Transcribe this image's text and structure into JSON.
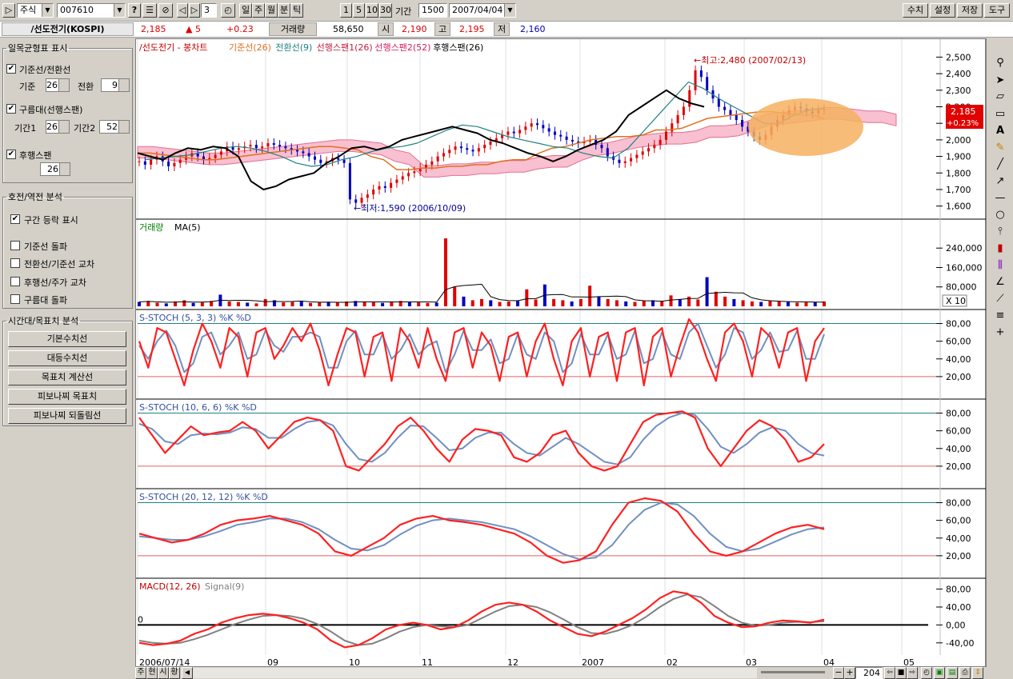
{
  "toolbar": {
    "market": "주식",
    "code": "007610",
    "count_value": "3",
    "period_buttons": [
      "일",
      "주",
      "월",
      "분",
      "틱"
    ],
    "interval_buttons": [
      "1",
      "5",
      "10",
      "30"
    ],
    "period_label": "기간",
    "period_value": "1500",
    "date_value": "2007/04/04",
    "right_buttons": [
      "수치",
      "설정",
      "저장",
      "도구"
    ]
  },
  "info": {
    "name": "/선도전기(KOSPI)",
    "price": "2,185",
    "change": "▲ 5",
    "change_pct": "+0.23",
    "volume_label": "거래량",
    "volume": "58,650",
    "open_label": "시",
    "open": "2,190",
    "high_label": "고",
    "high": "2,195",
    "low_label": "저",
    "low": "2,160"
  },
  "left_panel": {
    "ichimoku_title": "일목균형표 표시",
    "base_conv_label": "기준선/전환선",
    "base_label": "기준",
    "base_value": "26",
    "conv_label": "전환",
    "conv_value": "9",
    "cloud_label": "구름대(선행스팬)",
    "period1_label": "기간1",
    "period1_value": "26",
    "period2_label": "기간2",
    "period2_value": "52",
    "lagging_label": "후행스팬",
    "lagging_value": "26",
    "reversal_title": "호전/역전 분석",
    "range_label": "구간 등락 표시",
    "opt1": "기준선 돌파",
    "opt2": "전환선/기준선 교차",
    "opt3": "후행선/주가 교차",
    "opt4": "구름대 돌파",
    "time_title": "시간대/목표치 분석",
    "buttons": [
      "기본수치선",
      "대등수치선",
      "목표치 계산선",
      "피보나찌 목표치",
      "피보나찌 되돌림선"
    ]
  },
  "chart_data": [
    {
      "type": "line",
      "title": "/선도전기 - 봉차트",
      "legend": [
        "기준선(26)",
        "전환선(9)",
        "선행스팬1(26)",
        "선행스팬2(52)",
        "후행스팬(26)"
      ],
      "legend_colors": [
        "#e07020",
        "#208080",
        "#c02040",
        "#d02060",
        "#000000"
      ],
      "y_ticks": [
        "2,500",
        "2,400",
        "2,300",
        "2,200",
        "2,100",
        "2,000",
        "1,900",
        "1,800",
        "1,700",
        "1,600"
      ],
      "ylim": [
        1550,
        2560
      ],
      "price_tag": "2,185",
      "price_tag_pct": "+0.23%",
      "high_annotation": "←최고:2,480 (2007/02/13)",
      "low_annotation": "←최저:1,590 (2006/10/09)",
      "close": [
        1870,
        1850,
        1880,
        1900,
        1870,
        1840,
        1860,
        1880,
        1900,
        1920,
        1900,
        1880,
        1890,
        1910,
        1930,
        1960,
        1940,
        1950,
        1960,
        1970,
        1950,
        1960,
        1980,
        1970,
        1960,
        1950,
        1940,
        1930,
        1920,
        1900,
        1880,
        1860,
        1870,
        1890,
        1880,
        1860,
        1640,
        1620,
        1650,
        1670,
        1700,
        1720,
        1710,
        1740,
        1760,
        1780,
        1800,
        1810,
        1830,
        1850,
        1870,
        1900,
        1920,
        1940,
        1960,
        1950,
        1940,
        1930,
        1950,
        1970,
        1990,
        2010,
        2030,
        2050,
        2040,
        2060,
        2080,
        2100,
        2090,
        2070,
        2050,
        2030,
        2020,
        2000,
        1990,
        1980,
        1990,
        2000,
        1970,
        1950,
        1900,
        1880,
        1860,
        1870,
        1890,
        1910,
        1930,
        1950,
        1970,
        2000,
        2050,
        2100,
        2150,
        2200,
        2300,
        2420,
        2380,
        2300,
        2250,
        2200,
        2180,
        2150,
        2120,
        2080,
        2050,
        2020,
        2000,
        2030,
        2080,
        2120,
        2150,
        2180,
        2200,
        2190,
        2170,
        2160,
        2180,
        2185
      ],
      "kijun": [
        1920,
        1920,
        1910,
        1900,
        1890,
        1880,
        1880,
        1890,
        1900,
        1910,
        1920,
        1930,
        1940,
        1950,
        1960,
        1960,
        1950,
        1940,
        1900,
        1880,
        1820,
        1820,
        1830,
        1830,
        1840,
        1840,
        1850,
        1850,
        1870,
        1880,
        1880,
        1920,
        1950,
        1960,
        1980,
        2000,
        2010,
        2020,
        2020,
        2030,
        2060,
        2060,
        2070,
        2100,
        2130,
        2140,
        2150,
        2160,
        2170,
        2170,
        2160,
        2150,
        2150,
        2130
      ],
      "tenkan": [
        1880,
        1890,
        1900,
        1910,
        1930,
        1950,
        1960,
        1950,
        1930,
        1900,
        1860,
        1840,
        1850,
        1880,
        1900,
        1930,
        1950,
        1960,
        1980,
        2020,
        2060,
        2090,
        2080,
        2050,
        2020,
        2000,
        1980,
        1960,
        1950,
        1920,
        1900,
        1890,
        1950,
        2050,
        2150,
        2250,
        2350,
        2310,
        2250,
        2200,
        2150,
        2100,
        2100,
        2150,
        2180,
        2190
      ],
      "lagging": [
        1920,
        1900,
        1880,
        1920,
        1950,
        1940,
        1960,
        1950,
        1900,
        1750,
        1700,
        1720,
        1760,
        1780,
        1800,
        1860,
        1900,
        1950,
        1960,
        1940,
        1960,
        2000,
        2020,
        2040,
        2060,
        2080,
        2060,
        2040,
        2000,
        1980,
        1950,
        1920,
        1900,
        1870,
        1900,
        1940,
        1970,
        2000,
        2050,
        2150,
        2200,
        2250,
        2300,
        2250,
        2220,
        2200
      ]
    },
    {
      "type": "bar",
      "title": "거래량",
      "ma_label": "MA(5)",
      "y_ticks": [
        "240,000",
        "160,000",
        "80,000"
      ],
      "ylim": [
        0,
        300000
      ],
      "multiplier_label": "X 10",
      "values": [
        18000,
        22000,
        15000,
        12000,
        20000,
        25000,
        14000,
        16000,
        22000,
        48000,
        20000,
        18000,
        15000,
        12000,
        30000,
        25000,
        16000,
        18000,
        20000,
        14000,
        16000,
        18000,
        15000,
        20000,
        22000,
        18000,
        16000,
        14000,
        20000,
        22000,
        18000,
        16000,
        14000,
        15000,
        280000,
        80000,
        40000,
        25000,
        30000,
        25000,
        18000,
        20000,
        22000,
        70000,
        28000,
        90000,
        30000,
        25000,
        20000,
        30000,
        85000,
        40000,
        30000,
        25000,
        20000,
        18000,
        22000,
        25000,
        20000,
        45000,
        30000,
        40000,
        28000,
        120000,
        60000,
        40000,
        30000,
        25000,
        20000,
        18000,
        22000,
        20000,
        18000,
        15000,
        16000,
        18000,
        20000
      ]
    },
    {
      "type": "line",
      "title": "S-STOCH (5, 3, 3) %K %D",
      "y_ticks": [
        "80,00",
        "60,00",
        "40,00",
        "20,00"
      ],
      "ylim": [
        0,
        85
      ],
      "levels": [
        80,
        20
      ],
      "k": [
        60,
        30,
        75,
        70,
        40,
        10,
        50,
        80,
        60,
        30,
        75,
        65,
        20,
        70,
        75,
        40,
        55,
        75,
        60,
        80,
        50,
        10,
        45,
        75,
        70,
        20,
        65,
        70,
        15,
        75,
        60,
        30,
        75,
        40,
        15,
        70,
        75,
        30,
        70,
        55,
        15,
        65,
        70,
        20,
        60,
        80,
        40,
        10,
        60,
        75,
        20,
        65,
        70,
        15,
        70,
        75,
        10,
        65,
        75,
        20,
        55,
        85,
        70,
        40,
        15,
        70,
        80,
        60,
        20,
        75,
        65,
        30,
        70,
        75,
        15,
        60,
        75
      ],
      "d": [
        55,
        40,
        60,
        72,
        55,
        25,
        35,
        65,
        70,
        45,
        55,
        70,
        40,
        45,
        72,
        55,
        48,
        65,
        65,
        70,
        65,
        30,
        30,
        60,
        72,
        45,
        45,
        68,
        40,
        50,
        68,
        45,
        55,
        60,
        25,
        45,
        72,
        50,
        50,
        62,
        35,
        40,
        68,
        45,
        40,
        70,
        60,
        25,
        35,
        68,
        45,
        45,
        68,
        40,
        45,
        72,
        35,
        40,
        70,
        45,
        40,
        70,
        80,
        55,
        30,
        45,
        75,
        70,
        40,
        50,
        70,
        48,
        50,
        72,
        40,
        40,
        68
      ]
    },
    {
      "type": "line",
      "title": "S-STOCH (10, 6, 6) %K %D",
      "y_ticks": [
        "80,00",
        "60,00",
        "40,00",
        "20,00"
      ],
      "ylim": [
        0,
        85
      ],
      "levels": [
        80,
        20
      ],
      "k": [
        75,
        55,
        35,
        50,
        65,
        55,
        58,
        60,
        70,
        60,
        40,
        55,
        70,
        75,
        72,
        60,
        20,
        15,
        30,
        45,
        65,
        75,
        60,
        40,
        25,
        50,
        62,
        60,
        55,
        30,
        25,
        35,
        55,
        60,
        35,
        20,
        15,
        20,
        45,
        70,
        78,
        80,
        82,
        75,
        40,
        20,
        40,
        60,
        72,
        65,
        50,
        25,
        30,
        45
      ],
      "d": [
        68,
        62,
        48,
        45,
        55,
        57,
        56,
        58,
        64,
        62,
        52,
        52,
        62,
        70,
        72,
        66,
        45,
        28,
        25,
        35,
        52,
        66,
        65,
        52,
        38,
        40,
        52,
        58,
        58,
        45,
        35,
        32,
        42,
        52,
        45,
        35,
        25,
        22,
        30,
        50,
        65,
        75,
        80,
        78,
        62,
        42,
        35,
        45,
        58,
        64,
        60,
        45,
        35,
        32
      ]
    },
    {
      "type": "line",
      "title": "S-STOCH (20, 12, 12) %K %D",
      "y_ticks": [
        "80,00",
        "60,00",
        "40,00",
        "20,00"
      ],
      "ylim": [
        0,
        85
      ],
      "levels": [
        80,
        20
      ],
      "k": [
        45,
        40,
        35,
        38,
        45,
        55,
        60,
        62,
        65,
        60,
        55,
        45,
        25,
        20,
        30,
        40,
        55,
        62,
        65,
        60,
        58,
        55,
        50,
        45,
        35,
        20,
        12,
        15,
        25,
        55,
        80,
        85,
        82,
        70,
        45,
        25,
        20,
        25,
        35,
        45,
        52,
        55,
        50
      ],
      "d": [
        42,
        40,
        38,
        38,
        42,
        48,
        55,
        58,
        62,
        62,
        58,
        50,
        38,
        28,
        26,
        32,
        44,
        54,
        60,
        62,
        60,
        58,
        54,
        50,
        42,
        32,
        22,
        16,
        18,
        32,
        55,
        72,
        80,
        78,
        65,
        45,
        30,
        25,
        28,
        36,
        44,
        50,
        52
      ]
    },
    {
      "type": "line",
      "title": "MACD(12, 26)",
      "signal_label": "Signal(9)",
      "zero_label": "0",
      "y_ticks": [
        "80,00",
        "40,00",
        "0,00",
        "-40,00"
      ],
      "ylim": [
        -60,
        90
      ],
      "macd": [
        -40,
        -45,
        -42,
        -35,
        -20,
        -10,
        5,
        15,
        22,
        25,
        22,
        15,
        5,
        -10,
        -35,
        -50,
        -45,
        -30,
        -10,
        0,
        5,
        0,
        -10,
        -5,
        10,
        30,
        45,
        50,
        45,
        30,
        10,
        -5,
        -20,
        -25,
        -15,
        0,
        15,
        35,
        60,
        75,
        70,
        50,
        20,
        5,
        -5,
        -3,
        5,
        10,
        8,
        5,
        12
      ],
      "signal": [
        -35,
        -40,
        -42,
        -40,
        -32,
        -22,
        -10,
        2,
        12,
        20,
        22,
        20,
        14,
        2,
        -15,
        -35,
        -45,
        -42,
        -30,
        -15,
        -5,
        0,
        -3,
        -5,
        0,
        15,
        30,
        42,
        45,
        40,
        28,
        12,
        -5,
        -18,
        -20,
        -12,
        0,
        18,
        40,
        58,
        68,
        62,
        42,
        20,
        5,
        -2,
        0,
        5,
        7,
        6,
        8
      ]
    }
  ],
  "x_axis_labels": [
    "2006/07/14",
    "09",
    "10",
    "11",
    "12",
    "2007",
    "02",
    "03",
    "04",
    "05"
  ],
  "bottom": {
    "tabs": [
      "주",
      "현",
      "시",
      "황"
    ],
    "zoom_value": "204"
  }
}
